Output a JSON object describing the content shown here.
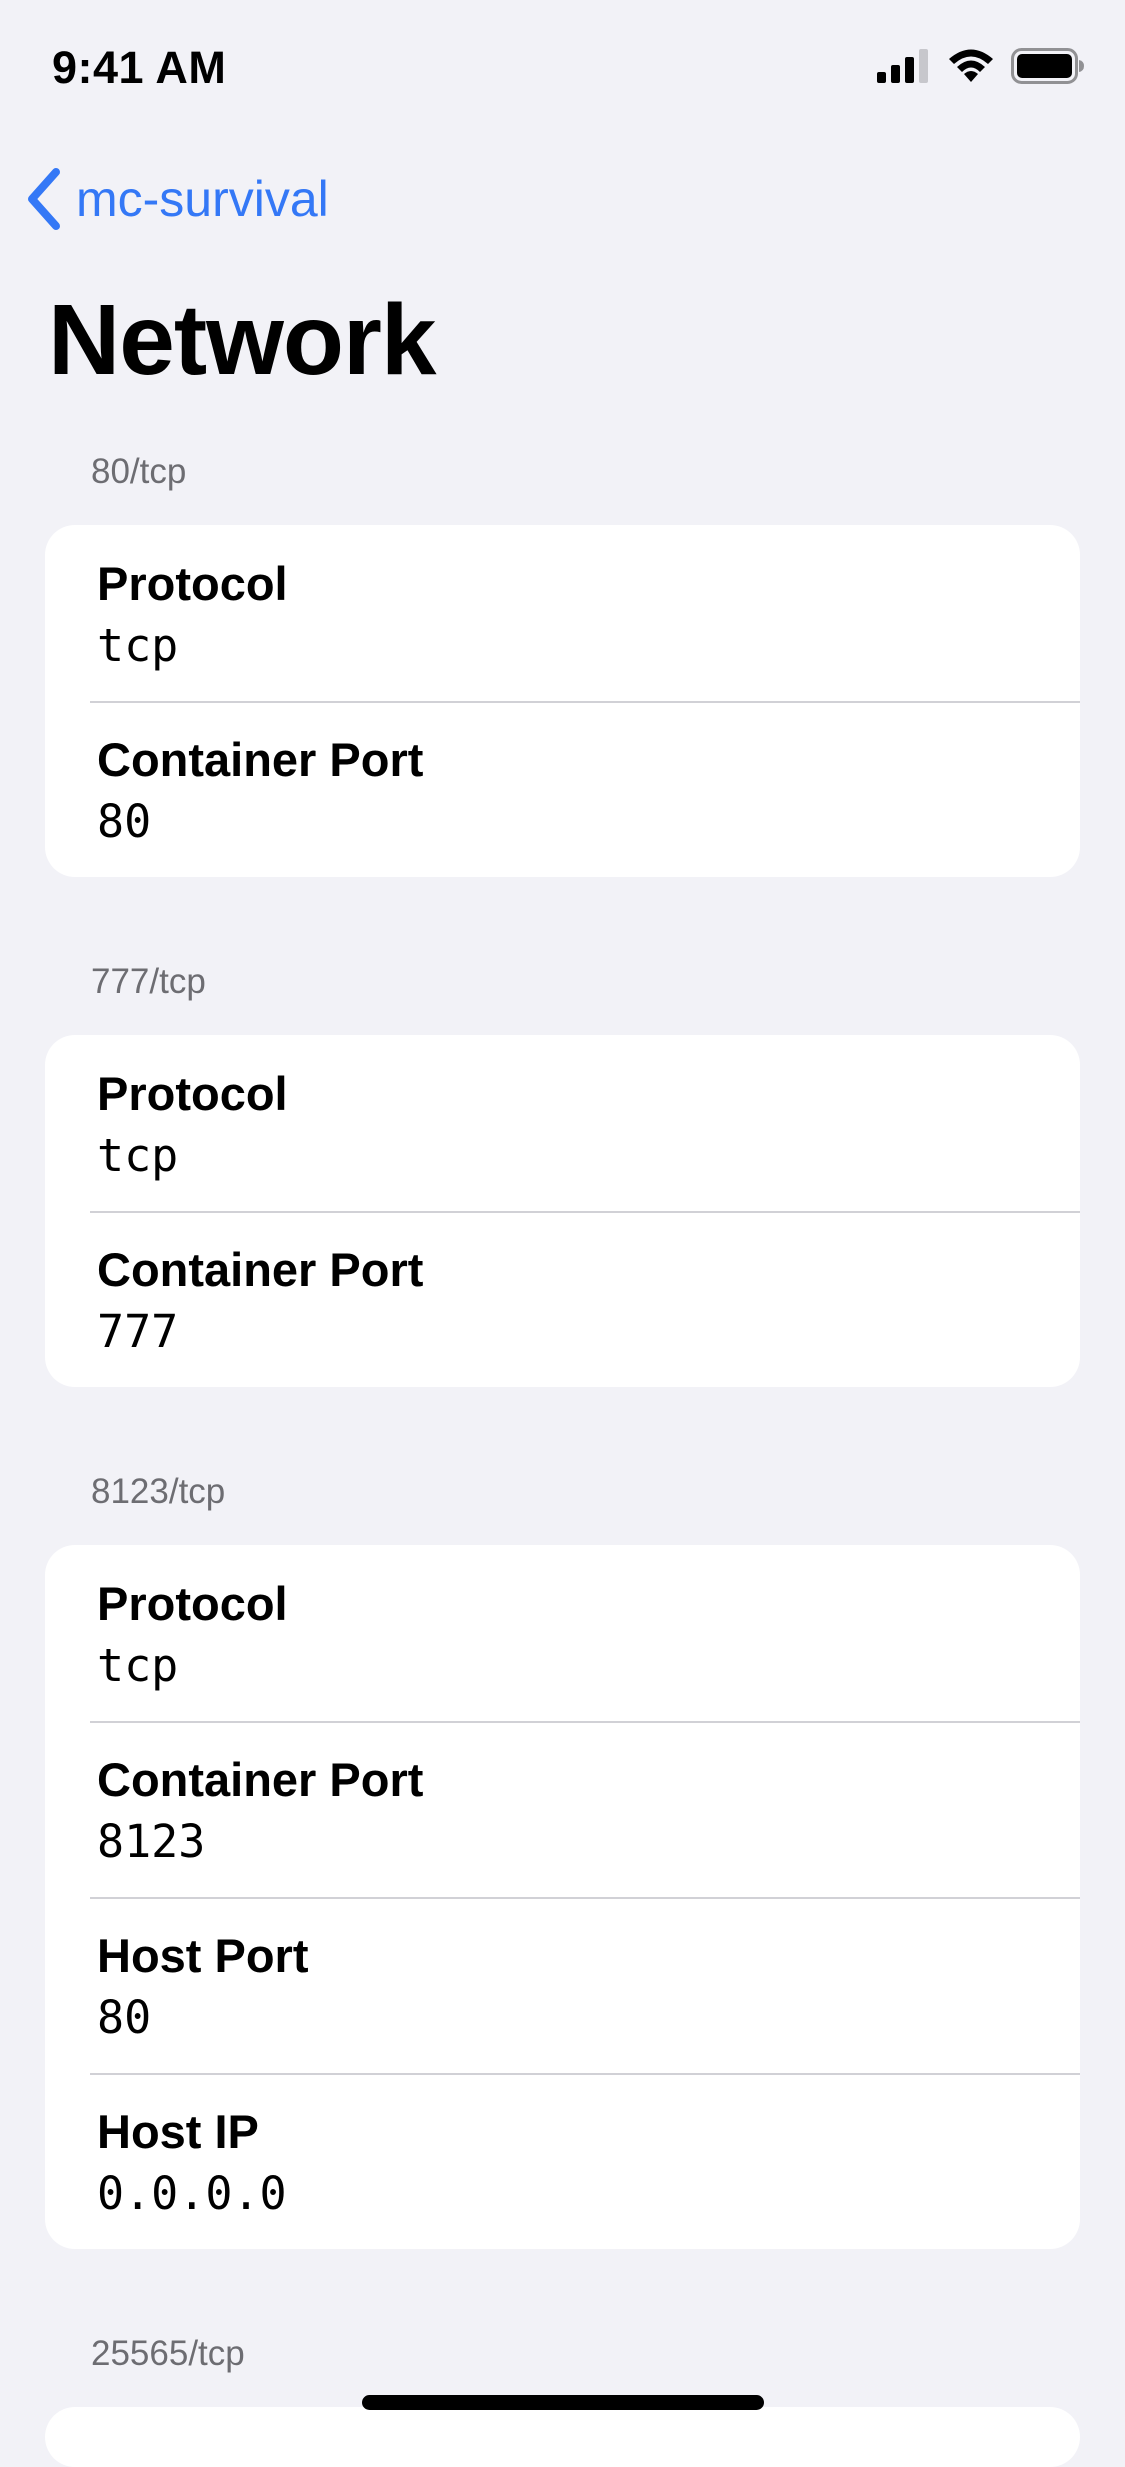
{
  "status_bar": {
    "time": "9:41 AM"
  },
  "nav": {
    "back_label": "mc-survival"
  },
  "title": "Network",
  "sections": [
    {
      "header": "80/tcp",
      "rows": [
        {
          "label": "Protocol",
          "value": "tcp"
        },
        {
          "label": "Container Port",
          "value": "80"
        }
      ]
    },
    {
      "header": "777/tcp",
      "rows": [
        {
          "label": "Protocol",
          "value": "tcp"
        },
        {
          "label": "Container Port",
          "value": "777"
        }
      ]
    },
    {
      "header": "8123/tcp",
      "rows": [
        {
          "label": "Protocol",
          "value": "tcp"
        },
        {
          "label": "Container Port",
          "value": "8123"
        },
        {
          "label": "Host Port",
          "value": "80"
        },
        {
          "label": "Host IP",
          "value": "0.0.0.0"
        }
      ]
    },
    {
      "header": "25565/tcp",
      "rows": []
    }
  ],
  "colors": {
    "accent": "#3478f6",
    "background": "#f2f2f7",
    "card": "#ffffff",
    "separator": "#d1d1d6",
    "section_header": "#6d6d72"
  }
}
